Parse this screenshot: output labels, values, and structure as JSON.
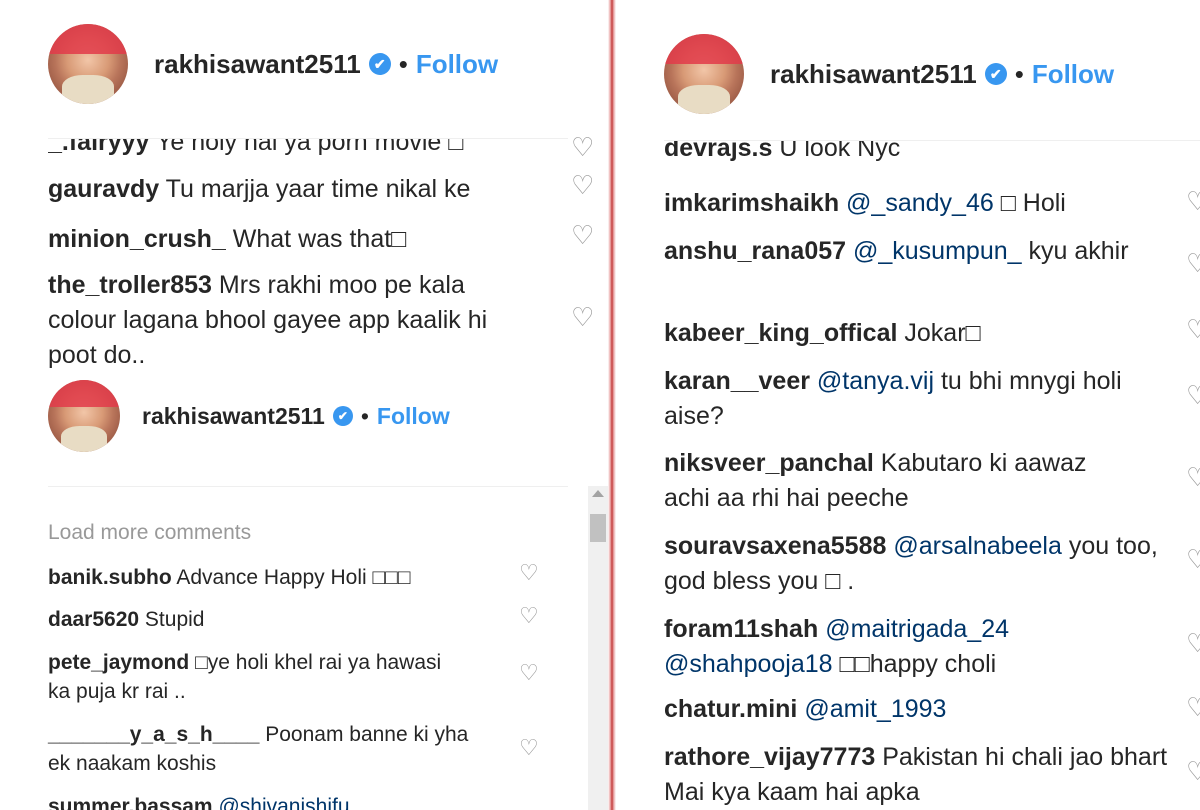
{
  "header": {
    "username": "rakhisawant2511",
    "verified_symbol": "✔",
    "separator": "•",
    "follow_label": "Follow"
  },
  "left": {
    "top_comments": [
      {
        "user": "_.fairyyy",
        "text": "Ye holy hai ya porn movie □"
      },
      {
        "user": "gauravdy",
        "text": "Tu marjja yaar time nikal ke"
      },
      {
        "user": "minion_crush_",
        "text": "What was that□"
      },
      {
        "user": "the_troller853",
        "text": "Mrs rakhi moo pe kala colour lagana bhool gayee app kaalik hi poot do.."
      }
    ],
    "load_more": "Load more comments",
    "bottom_comments": [
      {
        "user": "banik.subho",
        "text": "Advance Happy Holi □□□"
      },
      {
        "user": "daar5620",
        "text": "Stupid"
      },
      {
        "user": "pete_jaymond",
        "text": "□ye holi khel rai ya hawasi ka puja kr rai .."
      },
      {
        "user": "_______y_a_s_h____",
        "text": "Poonam banne ki yha ek naakam koshis"
      },
      {
        "user": "summer.bassam",
        "mention": "@shivanishifu",
        "text": ""
      }
    ]
  },
  "right": {
    "comments": [
      {
        "user": "devrajs.s",
        "mention": "",
        "text": "U look Nyc"
      },
      {
        "user": "imkarimshaikh",
        "mention": "@_sandy_46",
        "text": "□ Holi"
      },
      {
        "user": "anshu_rana057",
        "mention": "@_kusumpun_",
        "text": "kyu akhir"
      },
      {
        "user": "kabeer_king_offical",
        "mention": "",
        "text": "Jokar□"
      },
      {
        "user": "karan__veer",
        "mention": "@tanya.vij",
        "text": "tu bhi mnygi holi aise?"
      },
      {
        "user": "niksveer_panchal",
        "mention": "",
        "text": "Kabutaro ki aawaz achi aa rhi hai peeche"
      },
      {
        "user": "souravsaxena5588",
        "mention": "@arsalnabeela",
        "text": "you too, god bless you □ ."
      },
      {
        "user": "foram11shah",
        "mention": "@maitrigada_24 @shahpooja18",
        "text": "□□happy choli"
      },
      {
        "user": "chatur.mini",
        "mention": "@amit_1993",
        "text": ""
      },
      {
        "user": "rathore_vijay7773",
        "mention": "",
        "text": "Pakistan hi chali jao bhart Mai kya kaam hai apka"
      }
    ]
  },
  "icons": {
    "heart": "heart-icon",
    "verified": "verified-badge-icon"
  },
  "colors": {
    "link": "#3897f0",
    "mention": "#003569",
    "text": "#262626",
    "muted": "#999999"
  }
}
